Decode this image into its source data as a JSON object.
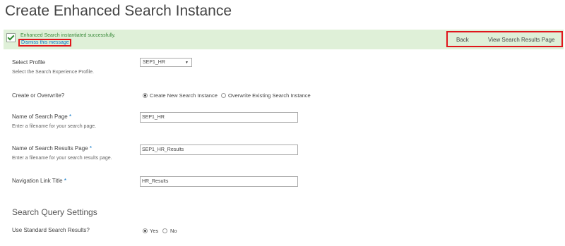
{
  "page": {
    "title": "Create Enhanced Search Instance"
  },
  "banner": {
    "message": "Enhanced Search instantiated successfully.",
    "dismiss_label": "Dismiss this message"
  },
  "actions": {
    "back_label": "Back",
    "view_results_label": "View Search Results Page"
  },
  "form": {
    "select_profile": {
      "label": "Select Profile",
      "description": "Select the Search Experience Profile.",
      "selected_value": "SEP1_HR"
    },
    "create_overwrite": {
      "label": "Create or Overwrite?",
      "options": [
        "Create New Search Instance",
        "Overwrite Existing Search Instance"
      ],
      "selected_index": 0
    },
    "search_page_name": {
      "label": "Name of Search Page",
      "required_marker": "*",
      "description": "Enter a filename for your search page.",
      "value": "SEP1_HR"
    },
    "results_page_name": {
      "label": "Name of Search Results Page",
      "required_marker": "*",
      "description": "Enter a filename for your search results page.",
      "value": "SEP1_HR_Results"
    },
    "nav_link_title": {
      "label": "Navigation Link Title",
      "required_marker": "*",
      "value": "HR_Results"
    }
  },
  "query_settings": {
    "section_title": "Search Query Settings",
    "use_standard": {
      "label": "Use Standard Search Results?",
      "options": [
        "Yes",
        "No"
      ],
      "selected_index": 0
    }
  },
  "colors": {
    "banner_bg": "#dff0d8",
    "highlight_border": "#e0161c",
    "link": "#0072c6",
    "success_text": "#3a8a3a"
  },
  "icons": {
    "banner_icon": "checkbox-checked-icon",
    "select_arrow": "dropdown-arrow-icon"
  }
}
